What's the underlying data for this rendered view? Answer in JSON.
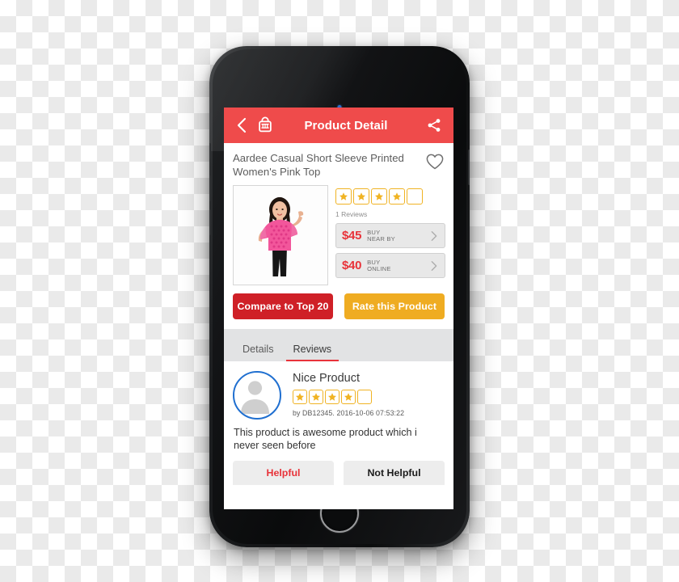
{
  "appbar": {
    "back_icon": "chevron-left-icon",
    "store_icon": "store-bag-icon",
    "title": "Product Detail",
    "share_icon": "share-icon"
  },
  "product": {
    "title": "Aardee Casual Short Sleeve Printed Women's Pink Top",
    "favorite_icon": "heart-outline-icon",
    "photo_alt": "woman wearing pink printed short sleeve top and black pants",
    "rating": 4,
    "rating_max": 5,
    "reviews_count_label": "1 Reviews",
    "prices": [
      {
        "amount": "$45",
        "line1": "BUY",
        "line2": "NEAR BY",
        "chevron": "chevron-right-icon"
      },
      {
        "amount": "$40",
        "line1": "BUY",
        "line2": "ONLINE",
        "chevron": "chevron-right-icon"
      }
    ]
  },
  "actions": {
    "compare_label": "Compare to Top 20",
    "rate_label": "Rate this Product"
  },
  "tabs": [
    {
      "label": "Details",
      "active": false
    },
    {
      "label": "Reviews",
      "active": true
    }
  ],
  "review": {
    "avatar_icon": "user-avatar-icon",
    "title": "Nice Product",
    "rating": 4,
    "rating_max": 5,
    "meta": "by DB12345. 2016-10-06 07:53:22",
    "body": "This product is awesome product which i never seen before",
    "helpful_label": "Helpful",
    "not_helpful_label": "Not Helpful"
  },
  "colors": {
    "brand_red": "#ef4b4b",
    "price_red": "#e8333a",
    "compare_red": "#cf2027",
    "rate_orange": "#efac22",
    "star_yellow": "#f0b323",
    "avatar_blue": "#1f6fd0"
  },
  "device": {
    "home_button": "home-button",
    "earpiece": "earpiece-speaker",
    "front_camera": "front-camera"
  }
}
